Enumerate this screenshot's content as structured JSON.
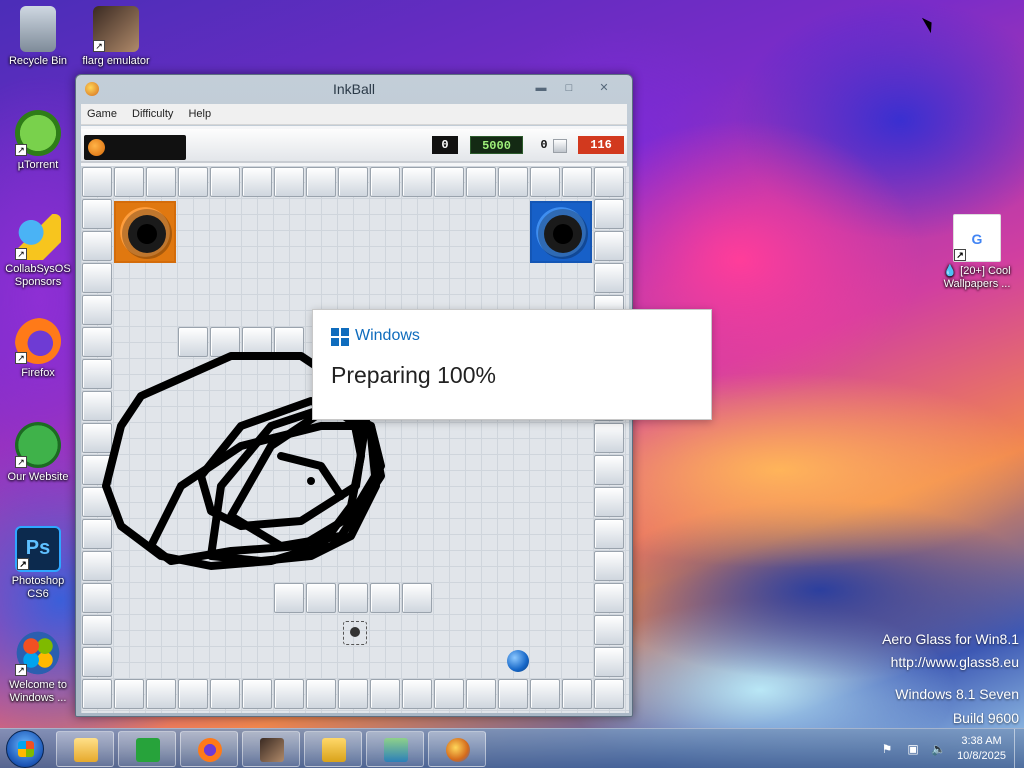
{
  "desktop": {
    "icons": [
      {
        "label": "Recycle Bin",
        "icon": "recycle-bin-icon"
      },
      {
        "label": "flarg emulator",
        "icon": "flarg-emulator-icon"
      },
      {
        "label": "µTorrent",
        "icon": "utorrent-icon"
      },
      {
        "label": "CollabSysOS Sponsors",
        "icon": "sponsors-star-icon"
      },
      {
        "label": "Firefox",
        "icon": "firefox-icon"
      },
      {
        "label": "Our Website",
        "icon": "website-globe-icon"
      },
      {
        "label": "Photoshop CS6",
        "icon": "photoshop-icon",
        "glyph": "Ps"
      },
      {
        "label": "Welcome to Windows ...",
        "icon": "windows-logo-icon"
      },
      {
        "label": "💧 [20+] Cool Wallpapers ...",
        "icon": "google-shortcut-icon",
        "glyph": "G"
      }
    ]
  },
  "inkball": {
    "title": "InkBall",
    "menu": [
      "Game",
      "Difficulty",
      "Help"
    ],
    "scores": {
      "left": "0",
      "points": "5000",
      "balls": "0",
      "time": "116"
    }
  },
  "dialog": {
    "brand": "Windows",
    "message": "Preparing 100%"
  },
  "watermark": {
    "line1": "Aero Glass for Win8.1",
    "line2": "http://www.glass8.eu",
    "line3": "Windows 8.1 Seven",
    "line4": "Build 9600"
  },
  "taskbar": {
    "buttons": [
      "file-explorer-icon",
      "store-icon",
      "firefox-icon",
      "flarg-icon",
      "archive-folder-icon",
      "installer-icon",
      "inkball-icon"
    ],
    "clock": {
      "time": "3:38 AM",
      "date": "10/8/2025"
    }
  },
  "colors": {
    "accent": "#0f6cbd",
    "time_box": "#d2391e",
    "points_text": "#9ff07a"
  }
}
